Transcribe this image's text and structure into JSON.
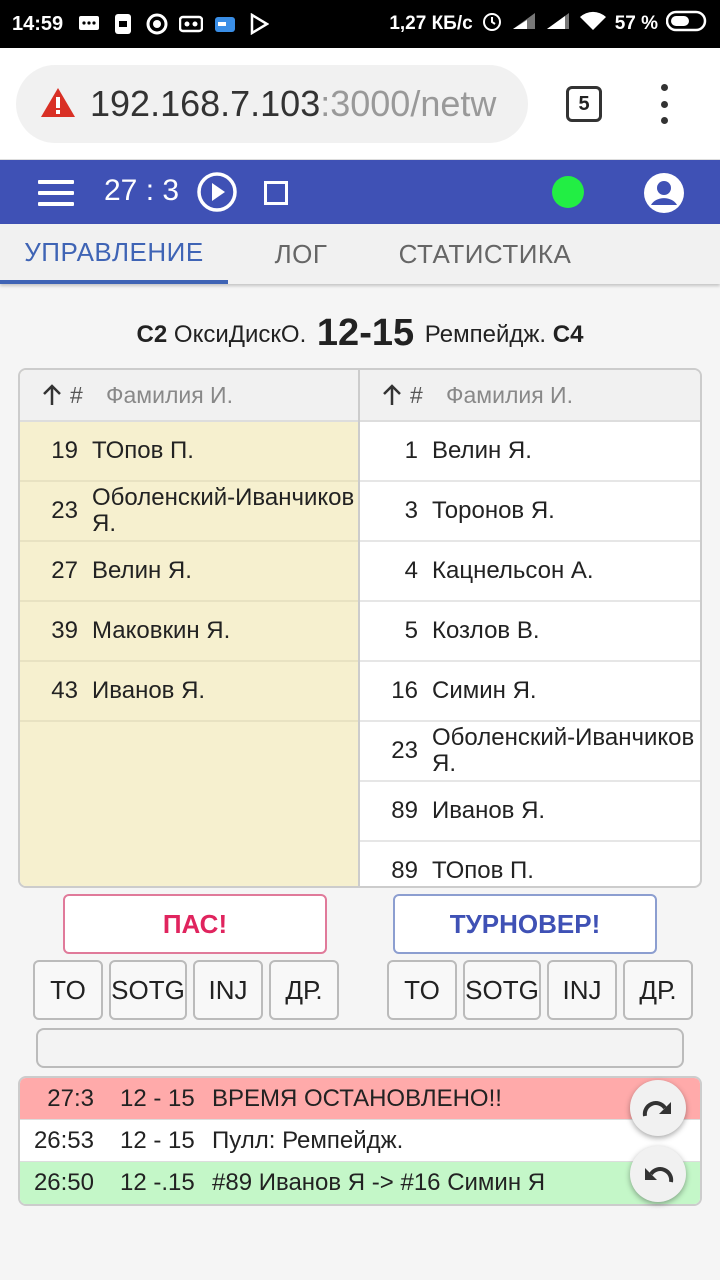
{
  "status": {
    "time": "14:59",
    "speed": "1,27 КБ/с",
    "battery": "57 %"
  },
  "browser": {
    "url_main": "192.168.7.103",
    "url_rest": ":3000/netw",
    "tab_count": "5"
  },
  "appbar": {
    "game_time": "27 : 3",
    "connection_color": "#22ee44"
  },
  "tabs": [
    {
      "label": "УПРАВЛЕНИЕ",
      "active": true
    },
    {
      "label": "ЛОГ",
      "active": false
    },
    {
      "label": "СТАТИСТИКА",
      "active": false
    }
  ],
  "scoreline": {
    "left_code": "C2",
    "left_team": "ОксиДискО.",
    "score": "12-15",
    "right_team": "Ремпейдж.",
    "right_code": "C4"
  },
  "roster_header": {
    "hash": "#",
    "name": "Фамилия И."
  },
  "left_roster": [
    {
      "num": "19",
      "name": "ТОпов П."
    },
    {
      "num": "23",
      "name": "Оболенский-Иванчиков Я."
    },
    {
      "num": "27",
      "name": "Велин Я."
    },
    {
      "num": "39",
      "name": "Маковкин Я."
    },
    {
      "num": "43",
      "name": "Иванов Я."
    }
  ],
  "right_roster": [
    {
      "num": "1",
      "name": "Велин Я."
    },
    {
      "num": "3",
      "name": "Торонов Я."
    },
    {
      "num": "4",
      "name": "Кацнельсон А."
    },
    {
      "num": "5",
      "name": "Козлов В."
    },
    {
      "num": "16",
      "name": "Симин Я."
    },
    {
      "num": "23",
      "name": "Оболенский-Иванчиков Я."
    },
    {
      "num": "89",
      "name": "Иванов Я."
    },
    {
      "num": "89",
      "name": "ТОпов П."
    }
  ],
  "actions": {
    "pass": "ПАС!",
    "turnover": "ТУРНОВЕР!"
  },
  "small_buttons": [
    "TO",
    "SOTG",
    "INJ",
    "ДР."
  ],
  "log": [
    {
      "time": "27:3",
      "score": "12 - 15",
      "msg": "ВРЕМЯ ОСТАНОВЛЕНО!!",
      "color": "#ffaaaa"
    },
    {
      "time": "26:53",
      "score": "12 - 15",
      "msg": "Пулл: Ремпейдж.",
      "color": "#ffffff"
    },
    {
      "time": "26:50",
      "score": "12 -.15",
      "msg": "#89 Иванов Я -> #16 Симин Я",
      "color": "#c4f7c8"
    }
  ]
}
